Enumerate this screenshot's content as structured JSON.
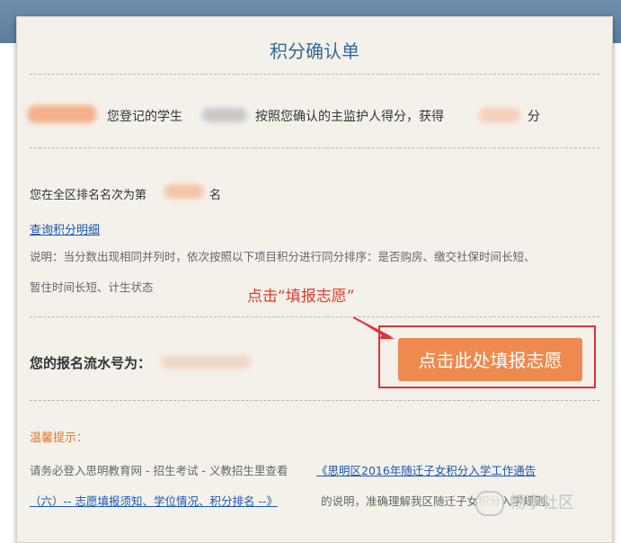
{
  "form": {
    "title": "积分确认单",
    "line1_pre": "您登记的学生",
    "line1_mid": "按照您确认的主监护人得分，获得",
    "line1_post": "分",
    "rank_pre": "您在全区排名名次为第",
    "rank_post": "名",
    "detail_link": "查询积分明细",
    "explain_1": "说明：当分数出现相同并列时，依次按照以下项目积分进行同分排序：是否购房、缴交社保时间长短、",
    "explain_2": "暂住时间长短、计生状态",
    "annotation": "点击“填报志愿”",
    "serial_label": "您的报名流水号为：",
    "fill_button": "点击此处填报志愿",
    "tips_title": "温馨提示：",
    "tips_pre": "请务必登入思明教育网 - 招生考试 - 义教招生里查看",
    "tips_link_1": "《思明区2016年随迁子女积分入学工作通告",
    "tips_link_2": "（六）-- 志愿填报须知、学位情况、积分排名 --》",
    "tips_post": "的说明，准确理解我区随迁子女积分入学规则。"
  },
  "watermark": "畅享社区",
  "colors": {
    "title": "#2f6a96",
    "button": "#ee8a4e",
    "highlight_frame": "#e0323a",
    "tips_title": "#e07830",
    "link": "#1a56b8"
  }
}
